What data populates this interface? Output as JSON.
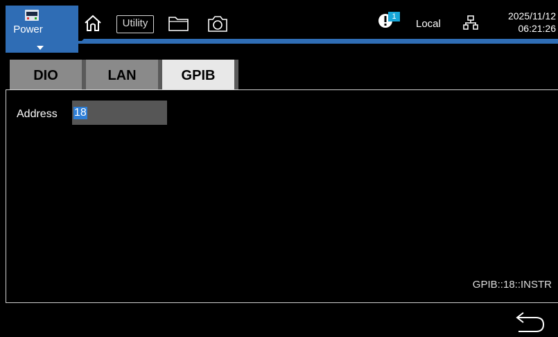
{
  "header": {
    "power_label": "Power",
    "utility_label": "Utility",
    "alert_count": "1",
    "remote_status": "Local",
    "date": "2025/11/12",
    "time": "06:21:26",
    "accent_color": "#2f6db5",
    "icons": [
      "power-supply-icon",
      "home-icon",
      "folder-icon",
      "camera-icon",
      "alert-icon",
      "network-icon"
    ]
  },
  "tabs": [
    {
      "label": "DIO",
      "active": false
    },
    {
      "label": "LAN",
      "active": false
    },
    {
      "label": "GPIB",
      "active": true
    }
  ],
  "gpib": {
    "address_label": "Address",
    "address_value": "18",
    "resource_string": "GPIB::18::INSTR"
  },
  "footer": {
    "back_icon": "back-arrow-icon"
  }
}
